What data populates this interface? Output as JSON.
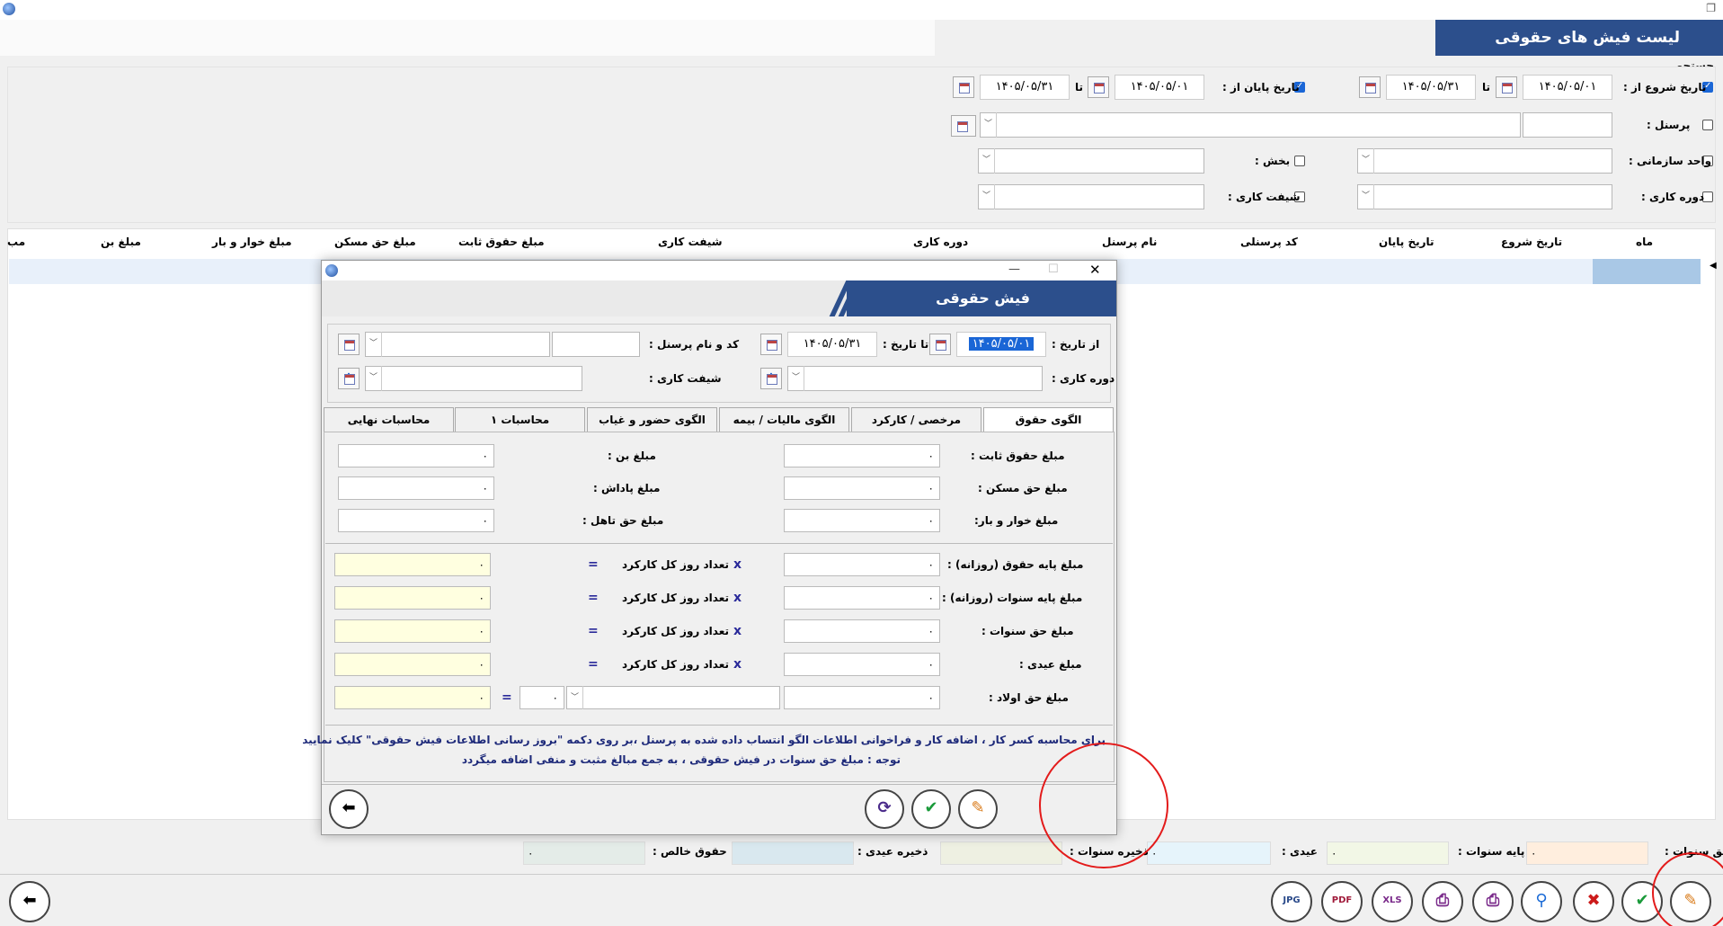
{
  "window": {
    "title_restore_icon": "restore-icon"
  },
  "banner": {
    "title": "لیست فیش های حقوقی"
  },
  "search": {
    "label": "جستجو",
    "start_date_label": "تاریخ شروع از :",
    "start_from": "۱۴۰۵/۰۵/۰۱",
    "to_label": "تا",
    "start_to": "۱۴۰۵/۰۵/۳۱",
    "end_date_label": "تاریخ پایان از :",
    "end_from": "۱۴۰۵/۰۵/۰۱",
    "end_to": "۱۴۰۵/۰۵/۳۱",
    "personnel_label": "پرسنل :",
    "org_unit_label": "واحد سازمانی :",
    "section_label": "بخش :",
    "period_label": "دوره کاری :",
    "shift_label": "شیفت کاری :"
  },
  "grid": {
    "columns": [
      "ماه",
      "تاریخ شروع",
      "تاریخ پایان",
      "کد پرسنلی",
      "نام پرسنل",
      "دوره کاری",
      "شیفت کاری",
      "مبلغ حقوق ثابت",
      "مبلغ حق مسکن",
      "مبلغ خوار و بار",
      "مبلغ بن",
      "مب"
    ]
  },
  "status": {
    "sanavat_label": "حق سنوات :",
    "sanavat_value": "۰",
    "base_sanavat_label": "پایه سنوات :",
    "base_sanavat_value": "۰",
    "eidi_label": "عیدی :",
    "eidi_value": "۰",
    "save_sanavat_label": "ذخیره سنوات :",
    "save_eidi_label": "ذخیره عیدی :",
    "net_label": "حقوق خالص :",
    "net_value": "۰"
  },
  "dialog": {
    "title": "فیش حقوقی",
    "from_date_label": "از تاریخ :",
    "from_date": "۱۴۰۵/۰۵/۰۱",
    "to_date_label": "تا تاریخ :",
    "to_date": "۱۴۰۵/۰۵/۳۱",
    "personnel_label": "کد و نام پرسنل :",
    "period_label": "دوره کاری :",
    "shift_label": "شیفت کاری :",
    "tabs": [
      "الگوی حقوق",
      "مرخصی / کارکرد",
      "الگوی مالیات / بیمه",
      "الگوی حضور و غیاب",
      "محاسبات ۱",
      "محاسبات نهایی"
    ],
    "fields": {
      "fixed_salary": "مبلغ حقوق ثابت :",
      "housing": "مبلغ حق مسکن :",
      "grocery": "مبلغ خوار و بار:",
      "bon": "مبلغ بن :",
      "bonus": "مبلغ پاداش :",
      "marriage": "مبلغ حق تاهل :",
      "base_daily": "مبلغ پایه حقوق (روزانه) :",
      "sanavat_daily": "مبلغ پایه سنوات (روزانه) :",
      "sanavat": "مبلغ حق سنوات :",
      "eidi": "مبلغ عیدی :",
      "children": "مبلغ حق اولاد :",
      "work_days": "تعداد روز کل کارکرد"
    },
    "zero": "۰",
    "x": "x",
    "eq": "=",
    "note1": "برای محاسبه کسر کار ، اضافه کار و فراخوانی اطلاعات الگو انتساب داده شده به پرسنل ،بر روی دکمه \"بروز رسانی اطلاعات فیش حقوقی\" کلیک نمایید",
    "note2": "توجه : مبلغ حق سنوات در فیش حقوقی ، به جمع مبالغ مثبت و منفی اضافه میگردد"
  },
  "colors": {
    "banner": "#2c4f8c",
    "highlight": "#ffffe0",
    "annotation": "#e31b1b"
  },
  "toolbar_icons": [
    "edit-icon",
    "confirm-icon",
    "cancel-icon",
    "search-icon",
    "print-icon",
    "print-icon",
    "xls-icon",
    "pdf-icon",
    "jpg-icon",
    "back-icon"
  ],
  "toolbar_labels": {
    "xls": "XLS",
    "pdf": "PDF",
    "jpg": "JPG"
  }
}
